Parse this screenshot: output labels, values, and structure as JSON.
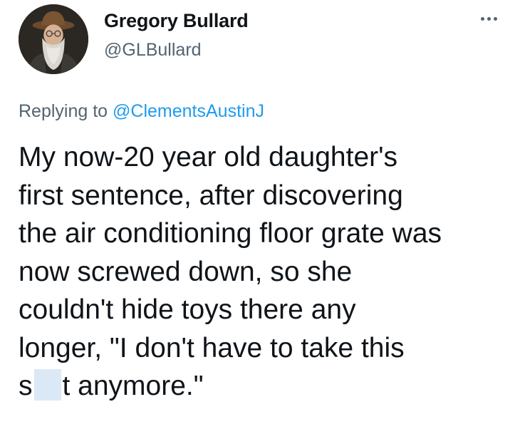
{
  "user": {
    "display_name": "Gregory Bullard",
    "handle": "@GLBullard",
    "avatar_icon": "profile-photo-avatar"
  },
  "more_icon": "more-horizontal-icon",
  "reply": {
    "prefix": "Replying to ",
    "mention": "@ClementsAustinJ"
  },
  "tweet": {
    "lines": [
      "My now-20 year old daughter's",
      "first sentence, after discovering",
      "the air conditioning floor grate was",
      "now screwed down, so she",
      "couldn't hide toys there any",
      "longer, \"I don't have to take this"
    ],
    "last_line_start": "s",
    "last_line_end": "t anymore.\""
  },
  "colors": {
    "text": "#0f1419",
    "secondary": "#536471",
    "link": "#1d9bf0",
    "censor_box": "#dbe9f7"
  }
}
